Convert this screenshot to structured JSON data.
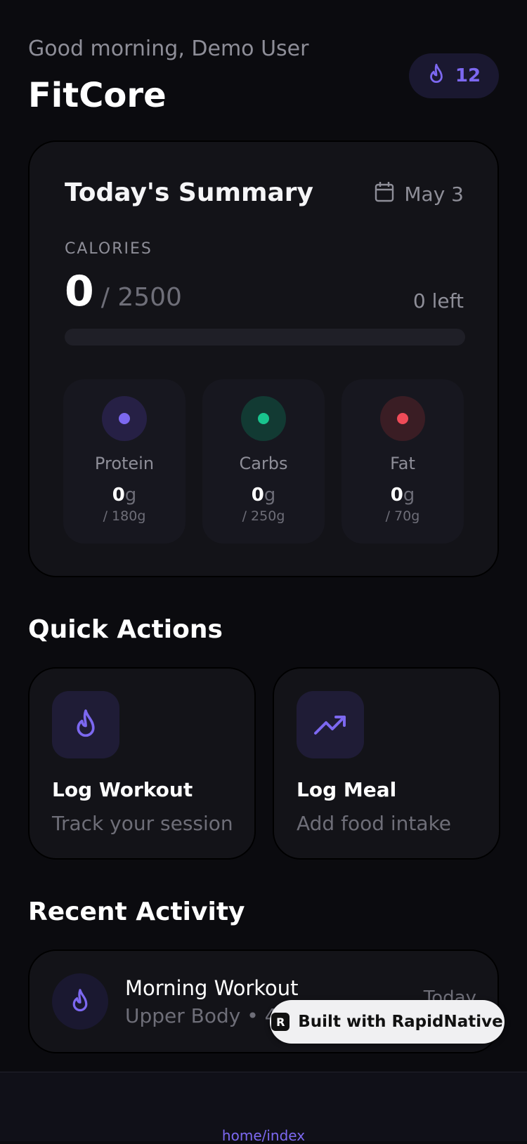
{
  "header": {
    "greeting": "Good morning, Demo User",
    "app_title": "FitCore",
    "streak_count": "12",
    "streak_icon": "flame-icon"
  },
  "summary": {
    "title": "Today's Summary",
    "date": "May 3",
    "calories_label": "CALORIES",
    "calories_value": "0",
    "calories_goal": "/ 2500",
    "calories_left": "0 left",
    "calories_progress_fraction": 0,
    "macros": [
      {
        "name": "Protein",
        "value": "0",
        "unit": "g",
        "goal": "/ 180g",
        "color": "#7c68f0"
      },
      {
        "name": "Carbs",
        "value": "0",
        "unit": "g",
        "goal": "/ 250g",
        "color": "#19c48e"
      },
      {
        "name": "Fat",
        "value": "0",
        "unit": "g",
        "goal": "/ 70g",
        "color": "#ef4b58"
      }
    ]
  },
  "quick_actions": {
    "title": "Quick Actions",
    "items": [
      {
        "title": "Log Workout",
        "desc": "Track your session",
        "icon": "flame-icon"
      },
      {
        "title": "Log Meal",
        "desc": "Add food intake",
        "icon": "trending-up-icon"
      }
    ]
  },
  "recent_activity": {
    "title": "Recent Activity",
    "items": [
      {
        "title": "Morning Workout",
        "subtitle": "Upper Body • 45",
        "when": "Today",
        "icon": "flame-icon"
      }
    ]
  },
  "badge": {
    "label": "Built with RapidNative",
    "logo_letter": "R"
  },
  "footer": {
    "route": "home/index"
  },
  "colors": {
    "accent": "#7c68f0",
    "background": "#0b0b0f",
    "card": "#131318"
  }
}
